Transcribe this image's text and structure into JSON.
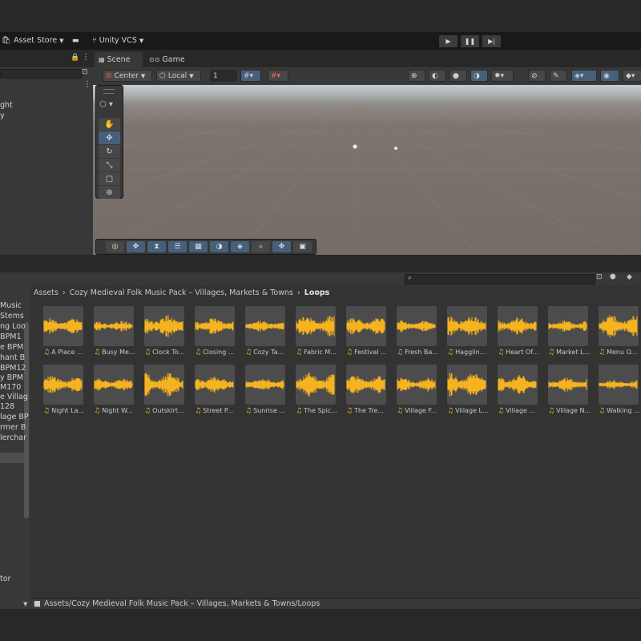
{
  "toolbar": {
    "asset_store_label": "Asset Store",
    "vcs_label": "Unity VCS"
  },
  "hierarchy": {
    "items": [
      "ght",
      "y"
    ]
  },
  "scene": {
    "tabs": [
      {
        "label": "Scene",
        "icon": "grid-icon"
      },
      {
        "label": "Game",
        "icon": "gamepad-icon"
      }
    ],
    "pivot_label": "Center",
    "space_label": "Local",
    "snap_value": "1"
  },
  "project": {
    "breadcrumbs": [
      "Assets",
      "Cozy Medieval Folk Music Pack – Villages, Markets & Towns",
      "Loops"
    ],
    "footer_path": "Assets/Cozy Medieval Folk Music Pack – Villages, Markets & Towns/Loops",
    "tree_items": [
      "Music",
      "Stems",
      "ng Loo",
      "BPM1",
      "e BPM",
      "hant B",
      "BPM12",
      "y BPM",
      "M170",
      "e Villag",
      "128",
      "lage BP",
      "rmer B",
      "lerchar",
      "",
      "",
      "",
      "",
      "",
      "",
      "",
      "",
      "",
      "",
      "tor"
    ],
    "assets": [
      {
        "label": "A Place ..."
      },
      {
        "label": "Busy Me..."
      },
      {
        "label": "Clock To..."
      },
      {
        "label": "Closing ..."
      },
      {
        "label": "Cozy Ta..."
      },
      {
        "label": "Fabric M..."
      },
      {
        "label": "Festival ..."
      },
      {
        "label": "Fresh Ba..."
      },
      {
        "label": "Hagglin..."
      },
      {
        "label": "Heart Of..."
      },
      {
        "label": "Market L..."
      },
      {
        "label": "Menu O..."
      },
      {
        "label": "Night La..."
      },
      {
        "label": "Night W..."
      },
      {
        "label": "Outskirt..."
      },
      {
        "label": "Street P..."
      },
      {
        "label": "Sunrise ..."
      },
      {
        "label": "The Spic..."
      },
      {
        "label": "The Tre..."
      },
      {
        "label": "Village F..."
      },
      {
        "label": "Village L..."
      },
      {
        "label": "Village ..."
      },
      {
        "label": "Village N..."
      },
      {
        "label": "Walking ..."
      }
    ]
  },
  "colors": {
    "waveform": "#f5b320",
    "accent": "#46607c"
  }
}
